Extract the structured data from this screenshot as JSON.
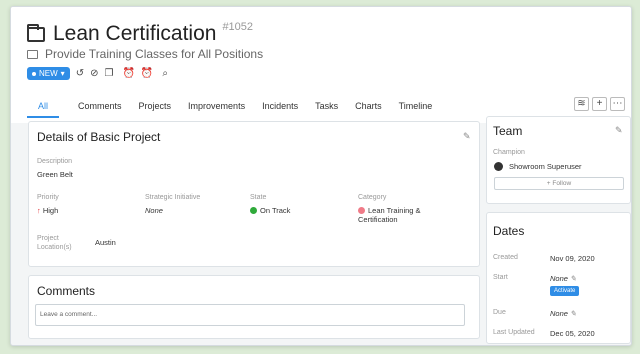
{
  "header": {
    "title": "Lean Certification",
    "id": "#1052",
    "subtitle": "Provide Training Classes for All Positions",
    "status": "NEW",
    "tool_icons": [
      "↺",
      "⊘",
      "❐",
      "⏰",
      "⏰",
      "⌕"
    ]
  },
  "tabs": [
    "All",
    "Comments",
    "Projects",
    "Improvements",
    "Incidents",
    "Tasks",
    "Charts",
    "Timeline"
  ],
  "details": {
    "title": "Details of Basic Project",
    "description_label": "Description",
    "description_value": "Green Belt",
    "priority_label": "Priority",
    "priority_value": "High",
    "strategic_label": "Strategic Initiative",
    "strategic_value": "None",
    "state_label": "State",
    "state_value": "On Track",
    "category_label": "Category",
    "category_value": "Lean Training & Certification",
    "location_label": "Project Location(s)",
    "location_value": "Austin"
  },
  "comments": {
    "title": "Comments",
    "placeholder": "Leave a comment..."
  },
  "team": {
    "title": "Team",
    "champion_label": "Champion",
    "champion_name": "Showroom Superuser",
    "follow_label": "Follow"
  },
  "dates": {
    "title": "Dates",
    "created_label": "Created",
    "created_value": "Nov 09, 2020",
    "start_label": "Start",
    "start_value": "None",
    "activate_label": "Activate",
    "due_label": "Due",
    "due_value": "None",
    "updated_label": "Last Updated",
    "updated_value": "Dec 05, 2020"
  },
  "colors": {
    "accent": "#2f8de6",
    "priority_high": "#e2353b",
    "on_track": "#2faa3a",
    "category_dot": "#f07b88"
  }
}
